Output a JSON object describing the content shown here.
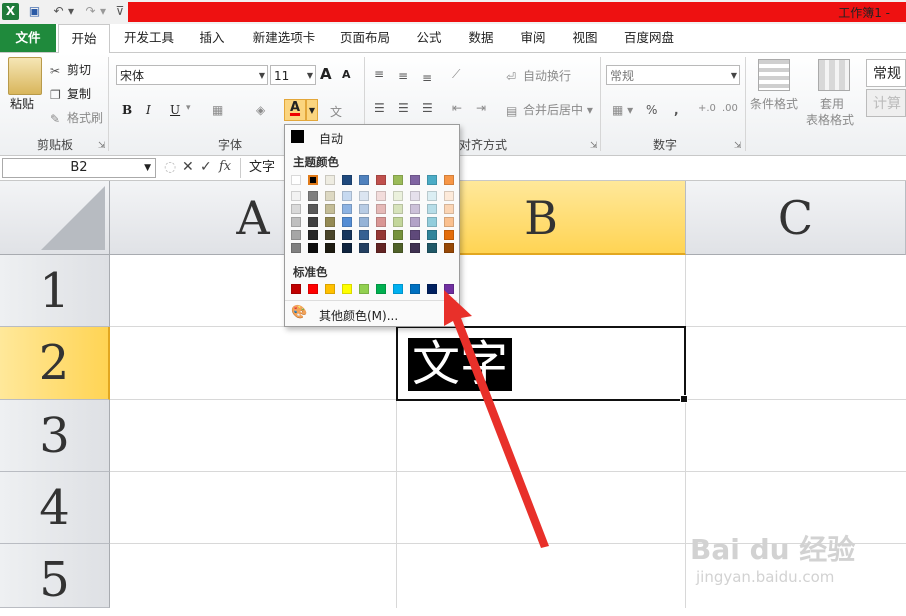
{
  "titlebar": {
    "title": "工作簿1 -",
    "undo_glyph": "↶",
    "redo_glyph": "↷",
    "dropdown_glyph": "▾",
    "custom_glyph": "⊽"
  },
  "tabs": [
    "文件",
    "开始",
    "开发工具",
    "插入",
    "新建选项卡",
    "页面布局",
    "公式",
    "数据",
    "审阅",
    "视图",
    "百度网盘"
  ],
  "clipboard": {
    "paste": "粘贴",
    "cut": "剪切",
    "copy": "复制",
    "format_painter": "格式刷",
    "label": "剪贴板"
  },
  "font": {
    "name": "宋体",
    "size": "11",
    "grow": "A",
    "shrink": "A",
    "bold": "B",
    "italic": "I",
    "underline": "U",
    "color_glyph": "A",
    "phonetic": "文",
    "label": "字体"
  },
  "alignment": {
    "wrap": "自动换行",
    "merge": "合并后居中",
    "label": "对齐方式"
  },
  "number": {
    "format": "常规",
    "percent": "%",
    "comma": ",",
    "label": "数字"
  },
  "styles": {
    "conditional": "条件格式",
    "table_line1": "套用",
    "table_line2": "表格格式",
    "style1": "常规",
    "style2": "计算"
  },
  "formula_bar": {
    "namebox": "B2",
    "cancel": "✕",
    "enter": "✓",
    "fx": "fx",
    "content": "文字"
  },
  "grid": {
    "columns": [
      "A",
      "B",
      "C"
    ],
    "rows": [
      "1",
      "2",
      "3",
      "4",
      "5"
    ],
    "selected_cell_text": "文字"
  },
  "palette": {
    "auto_label": "自动",
    "theme_header": "主题颜色",
    "standard_header": "标准色",
    "more_label": "其他颜色(M)...",
    "theme_top": [
      "#ffffff",
      "#000000",
      "#eeece1",
      "#1f497d",
      "#4f81bd",
      "#c0504d",
      "#9bbb59",
      "#8064a2",
      "#4bacc6",
      "#f79646"
    ],
    "theme_shades": [
      [
        "#f2f2f2",
        "#d9d9d9",
        "#bfbfbf",
        "#a6a6a6",
        "#808080"
      ],
      [
        "#7f7f7f",
        "#595959",
        "#404040",
        "#262626",
        "#0d0d0d"
      ],
      [
        "#ddd9c3",
        "#c4bd97",
        "#948a54",
        "#4a452a",
        "#1d1b10"
      ],
      [
        "#c6d9f0",
        "#8db3e2",
        "#548dd4",
        "#17365d",
        "#0f243e"
      ],
      [
        "#dbe5f1",
        "#b8cce4",
        "#95b3d7",
        "#366092",
        "#244061"
      ],
      [
        "#f2dcdb",
        "#e5b9b7",
        "#d99694",
        "#953734",
        "#632423"
      ],
      [
        "#ebf1dd",
        "#d7e3bc",
        "#c3d69b",
        "#76923c",
        "#4f6128"
      ],
      [
        "#e5e0ec",
        "#ccc1d9",
        "#b2a2c7",
        "#5f497a",
        "#3f3151"
      ],
      [
        "#dbeef3",
        "#b7dde8",
        "#92cddc",
        "#31859b",
        "#205867"
      ],
      [
        "#fdeada",
        "#fbd5b5",
        "#fac08f",
        "#e36c09",
        "#974806"
      ]
    ],
    "standard": [
      "#c00000",
      "#ff0000",
      "#ffc000",
      "#ffff00",
      "#92d050",
      "#00b050",
      "#00b0f0",
      "#0070c0",
      "#002060",
      "#7030a0"
    ]
  },
  "watermark": {
    "brand": "Bai du 经验",
    "url": "jingyan.baidu.com"
  }
}
